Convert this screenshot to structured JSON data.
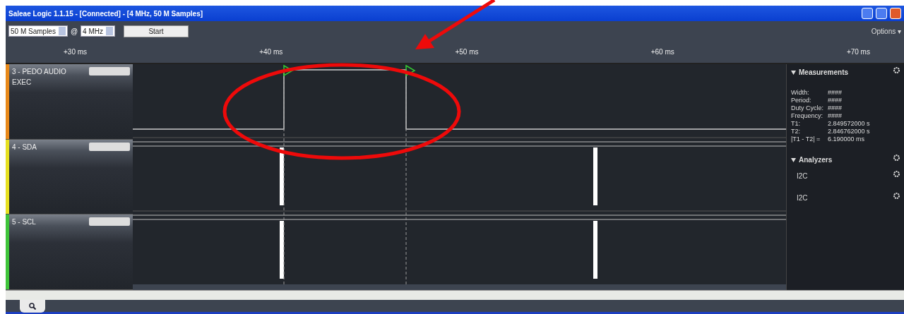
{
  "window": {
    "title": "Saleae Logic 1.1.15 - [Connected] - [4 MHz, 50 M Samples]"
  },
  "toolbar": {
    "samples": "50 M Samples",
    "at": "@",
    "rate": "4 MHz",
    "start_button": "Start",
    "options": "Options ▾"
  },
  "ruler": {
    "ticks": [
      "+30 ms",
      "+40 ms",
      "+50 ms",
      "+60 ms",
      "+70 ms"
    ]
  },
  "channels": [
    {
      "name": "3 - PEDO AUDIO EXEC",
      "color": "#e8891a"
    },
    {
      "name": "4 - SDA",
      "color": "#e6e020"
    },
    {
      "name": "5 - SCL",
      "color": "#3fc43a"
    }
  ],
  "measurements": {
    "title": "Measurements",
    "rows": [
      {
        "label": "Width:",
        "value": "####"
      },
      {
        "label": "Period:",
        "value": "####"
      },
      {
        "label": "Duty Cycle:",
        "value": "####"
      },
      {
        "label": "Frequency:",
        "value": "####"
      },
      {
        "label": "T1:",
        "value": "2.849572000 s"
      },
      {
        "label": "T2:",
        "value": "2.846762000 s"
      },
      {
        "label": "|T1 - T2| =",
        "value": "6.190000 ms"
      }
    ]
  },
  "analyzers": {
    "title": "Analyzers",
    "items": [
      "I2C",
      "I2C"
    ]
  }
}
